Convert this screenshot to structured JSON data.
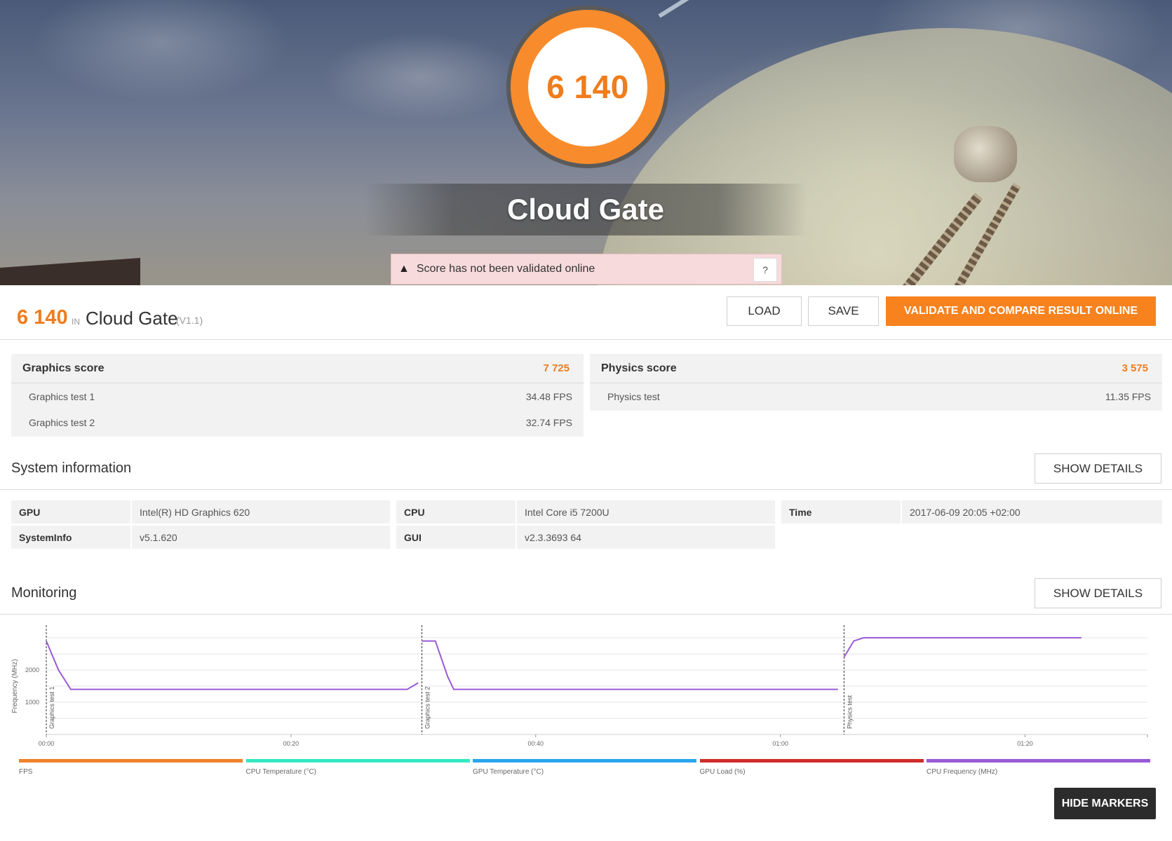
{
  "hero": {
    "score": "6 140",
    "benchmark_title": "Cloud Gate",
    "warning_text": "Score has not been validated online",
    "help_label": "?"
  },
  "result": {
    "score": "6 140",
    "in_label": "IN",
    "benchmark": "Cloud Gate",
    "version": "(V1.1)",
    "buttons": {
      "load": "LOAD",
      "save": "SAVE",
      "validate": "VALIDATE AND COMPARE RESULT ONLINE"
    }
  },
  "graphics": {
    "label": "Graphics score",
    "value": "7 725",
    "tests": [
      {
        "name": "Graphics test 1",
        "value": "34.48 FPS"
      },
      {
        "name": "Graphics test 2",
        "value": "32.74 FPS"
      }
    ]
  },
  "physics": {
    "label": "Physics score",
    "value": "3 575",
    "tests": [
      {
        "name": "Physics test",
        "value": "11.35 FPS"
      }
    ]
  },
  "system_info": {
    "title": "System information",
    "details_button": "SHOW DETAILS",
    "rows": [
      {
        "k": "GPU",
        "v": "Intel(R) HD Graphics 620"
      },
      {
        "k": "CPU",
        "v": "Intel Core i5 7200U"
      },
      {
        "k": "Time",
        "v": "2017-06-09 20:05 +02:00"
      },
      {
        "k": "SystemInfo",
        "v": "v5.1.620"
      },
      {
        "k": "GUI",
        "v": "v2.3.3693 64"
      }
    ]
  },
  "monitoring": {
    "title": "Monitoring",
    "details_button": "SHOW DETAILS",
    "hide_markers_button": "HIDE MARKERS",
    "legend": [
      {
        "name": "FPS",
        "color": "#f0822a"
      },
      {
        "name": "CPU Temperature (°C)",
        "color": "#34e8c0"
      },
      {
        "name": "GPU Temperature (°C)",
        "color": "#2aa6ee"
      },
      {
        "name": "GPU Load (%)",
        "color": "#d12b2b"
      },
      {
        "name": "CPU Frequency (MHz)",
        "color": "#9b5ad6"
      }
    ]
  },
  "chart_data": {
    "type": "line",
    "ylabel": "Frequency (MHz)",
    "ytick_labels": [
      "1000",
      "2000"
    ],
    "ylim": [
      0,
      3000
    ],
    "xlim": [
      0,
      90
    ],
    "xtick_labels": [
      "00:00",
      "00:20",
      "00:40",
      "01:00",
      "01:20"
    ],
    "xticks": [
      0,
      20,
      40,
      60,
      80
    ],
    "markers": [
      {
        "label": "Graphics test 1",
        "x": 0
      },
      {
        "label": "Graphics test 2",
        "x": 30.7
      },
      {
        "label": "Physics test",
        "x": 65.2
      }
    ],
    "series": [
      {
        "name": "CPU Frequency (MHz)",
        "color": "#9b5ad6",
        "segments": [
          [
            [
              0,
              2900
            ],
            [
              1,
              2000
            ],
            [
              2,
              1400
            ],
            [
              29.5,
              1400
            ],
            [
              30.4,
              1600
            ]
          ],
          [
            [
              30.7,
              2900
            ],
            [
              31.8,
              2900
            ],
            [
              32.8,
              1800
            ],
            [
              33.3,
              1400
            ],
            [
              64.7,
              1400
            ]
          ],
          [
            [
              65.2,
              2400
            ],
            [
              66,
              2900
            ],
            [
              66.8,
              3000
            ],
            [
              84.6,
              3000
            ]
          ]
        ]
      }
    ]
  }
}
